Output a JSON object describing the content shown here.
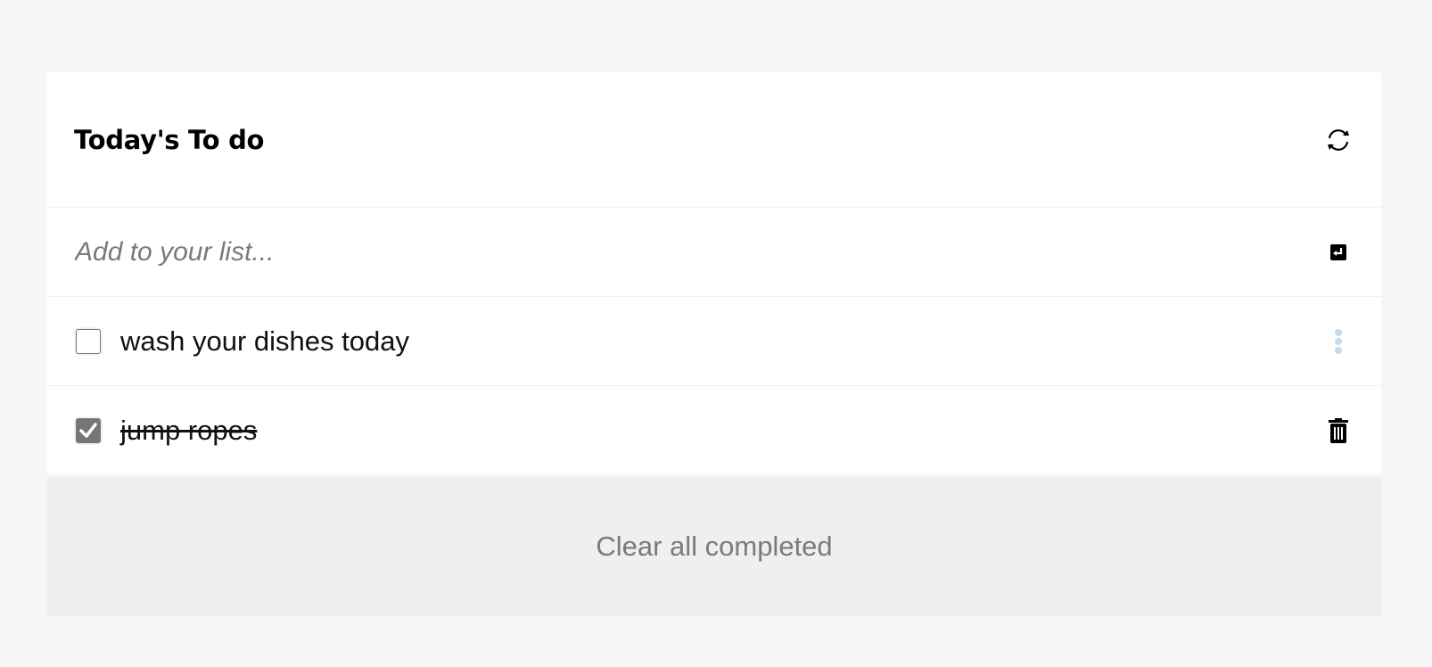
{
  "header": {
    "title": "Today's To do",
    "refresh_icon": "refresh-icon"
  },
  "add": {
    "placeholder": "Add to your list...",
    "value": "",
    "submit_icon": "enter-icon"
  },
  "todos": [
    {
      "text": "wash your dishes today",
      "completed": false,
      "action_icon": "more-vertical-icon",
      "action_color": "#c5d9ee"
    },
    {
      "text": "jump ropes",
      "completed": true,
      "action_icon": "trash-icon",
      "action_color": "#000000"
    }
  ],
  "footer": {
    "clear_label": "Clear all completed"
  },
  "colors": {
    "background": "#f6f6f6",
    "card": "#ffffff",
    "footer": "#efefef",
    "checked_box": "#767676",
    "muted_text": "#7a7a7a"
  }
}
